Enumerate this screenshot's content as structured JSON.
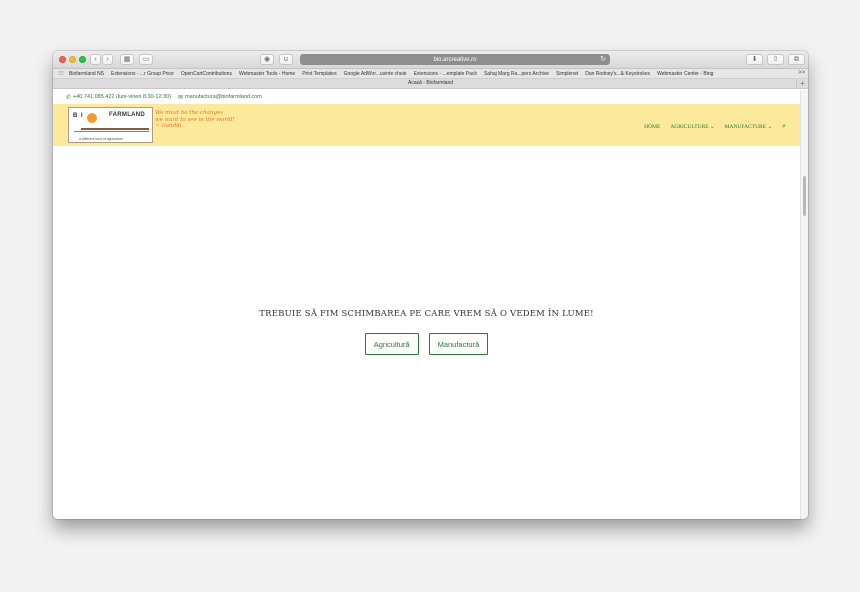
{
  "browser": {
    "address": "bio.arcreative.ro",
    "tab_title": "Acasă - Biofarmland",
    "bookmarks": [
      "Biofarmland NS",
      "Extensions - ...r Group Price",
      "OpenCartContributions",
      "Webmaster Tools - Home",
      "Print Templates",
      "Google AdWor...uvinte cheie",
      "Extensions - ...emplate Pack",
      "Sahaj Marg Ra...pers Archive",
      "Simplenet",
      "Dan Rodney's...& Keystrokes",
      "Webmaster Center - Bing"
    ],
    "bookmarks_more": ">>",
    "new_tab": "+"
  },
  "topbar": {
    "phone": "+40.741.085.422 (luni-vineri 8:30-12:30)",
    "email": "manufactura@biofarmland.com"
  },
  "logo": {
    "left_text": "B I",
    "right_text": "FARMLAND",
    "tagline": "a different kind of agriculture"
  },
  "quote": {
    "line1": "We must be the changes",
    "line2": "we want to see in the world!",
    "line3": "~ Gandhi"
  },
  "nav": {
    "items": [
      "HOME",
      "AGRICULTURE ⌄",
      "MANUFACTURE ⌄"
    ]
  },
  "hero": {
    "title": "TREBUIE SĂ FIM SCHIMBAREA PE CARE VREM SĂ O VEDEM ÎN LUME!",
    "button1": "Agricultură",
    "button2": "Manufactură"
  },
  "colors": {
    "header_bg": "#fde99b",
    "accent_green": "#2b7a3a",
    "quote_orange": "#e3792b"
  }
}
